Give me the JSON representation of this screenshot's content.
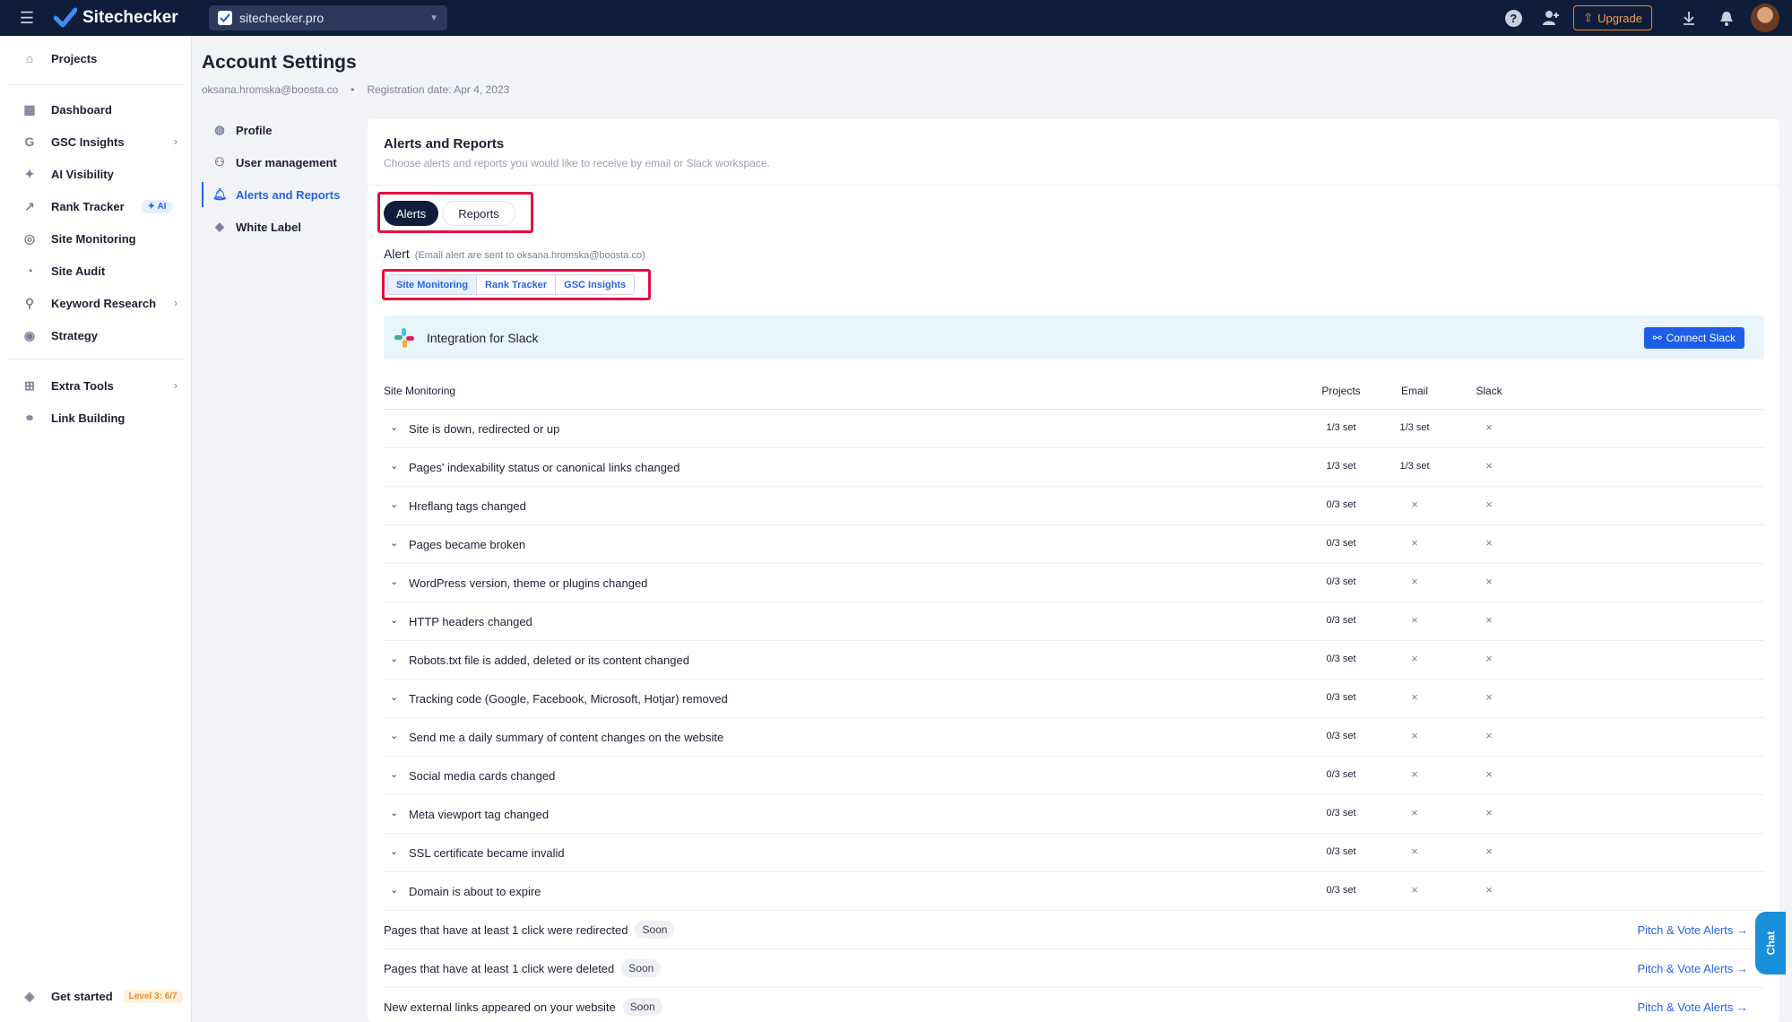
{
  "topbar": {
    "brand": "Sitechecker",
    "site_select": "sitechecker.pro",
    "upgrade_label": "Upgrade"
  },
  "sidebar": {
    "items": [
      {
        "label": "Projects",
        "icon": "home-icon"
      },
      {
        "label": "Dashboard",
        "icon": "dashboard-icon"
      },
      {
        "label": "GSC Insights",
        "icon": "google-icon"
      },
      {
        "label": "AI Visibility",
        "icon": "sparkle-icon"
      },
      {
        "label": "Rank Tracker",
        "icon": "trend-icon",
        "badge": "✦ AI"
      },
      {
        "label": "Site Monitoring",
        "icon": "monitor-icon"
      },
      {
        "label": "Site Audit",
        "icon": "gauge-icon"
      },
      {
        "label": "Keyword Research",
        "icon": "keyword-icon"
      },
      {
        "label": "Strategy",
        "icon": "target-icon"
      },
      {
        "label": "Extra Tools",
        "icon": "tools-icon"
      },
      {
        "label": "Link Building",
        "icon": "link-icon"
      }
    ],
    "get_started": "Get started",
    "level": "Level 3: 6/7"
  },
  "page": {
    "title": "Account Settings",
    "email": "oksana.hromska@boosta.co",
    "separator": "•",
    "registration": "Registration date: Apr 4, 2023"
  },
  "subnav": {
    "items": [
      {
        "label": "Profile"
      },
      {
        "label": "User management"
      },
      {
        "label": "Alerts and Reports"
      },
      {
        "label": "White Label"
      }
    ]
  },
  "card": {
    "title": "Alerts and Reports",
    "subtitle": "Choose alerts and reports you would like to receive by email or Slack workspace.",
    "toggle": {
      "alerts": "Alerts",
      "reports": "Reports"
    },
    "alert_label": "Alert",
    "alert_note": "(Email alert are sent to oksana.hromska@boosta.co)",
    "subtabs": [
      "Site Monitoring",
      "Rank Tracker",
      "GSC Insights"
    ],
    "slack": {
      "title": "Integration for Slack",
      "button": "Connect Slack"
    }
  },
  "table": {
    "headers": {
      "name": "Site Monitoring",
      "projects": "Projects",
      "email": "Email",
      "slack": "Slack"
    },
    "rows": [
      {
        "name": "Site is down, redirected or up",
        "projects": "1/3 set",
        "email": "1/3 set",
        "slack": "×"
      },
      {
        "name": "Pages' indexability status or canonical links changed",
        "projects": "1/3 set",
        "email": "1/3 set",
        "slack": "×"
      },
      {
        "name": "Hreflang tags changed",
        "projects": "0/3 set",
        "email": "×",
        "slack": "×"
      },
      {
        "name": "Pages became broken",
        "projects": "0/3 set",
        "email": "×",
        "slack": "×"
      },
      {
        "name": "WordPress version, theme or plugins changed",
        "projects": "0/3 set",
        "email": "×",
        "slack": "×"
      },
      {
        "name": "HTTP headers changed",
        "projects": "0/3 set",
        "email": "×",
        "slack": "×"
      },
      {
        "name": "Robots.txt file is added, deleted or its content changed",
        "projects": "0/3 set",
        "email": "×",
        "slack": "×"
      },
      {
        "name": "Tracking code (Google, Facebook, Microsoft, Hotjar) removed",
        "projects": "0/3 set",
        "email": "×",
        "slack": "×"
      },
      {
        "name": "Send me a daily summary of content changes on the website",
        "projects": "0/3 set",
        "email": "×",
        "slack": "×"
      },
      {
        "name": "Social media cards changed",
        "projects": "0/3 set",
        "email": "×",
        "slack": "×"
      },
      {
        "name": "Meta viewport tag changed",
        "projects": "0/3 set",
        "email": "×",
        "slack": "×"
      },
      {
        "name": "SSL certificate became invalid",
        "projects": "0/3 set",
        "email": "×",
        "slack": "×"
      },
      {
        "name": "Domain is about to expire",
        "projects": "0/3 set",
        "email": "×",
        "slack": "×"
      }
    ],
    "soon_rows": [
      {
        "name": "Pages that have at least 1 click were redirected",
        "badge": "Soon",
        "link": "Pitch & Vote Alerts →"
      },
      {
        "name": "Pages that have at least 1 click were deleted",
        "badge": "Soon",
        "link": "Pitch & Vote Alerts →"
      },
      {
        "name": "New external links appeared on your website",
        "badge": "Soon",
        "link": "Pitch & Vote Alerts →"
      }
    ]
  },
  "chat": {
    "label": "Chat"
  },
  "colors": {
    "accent": "#2763e8",
    "topbar": "#0f1c3a",
    "highlight": "#e3103f",
    "upgrade": "#f08a24"
  }
}
